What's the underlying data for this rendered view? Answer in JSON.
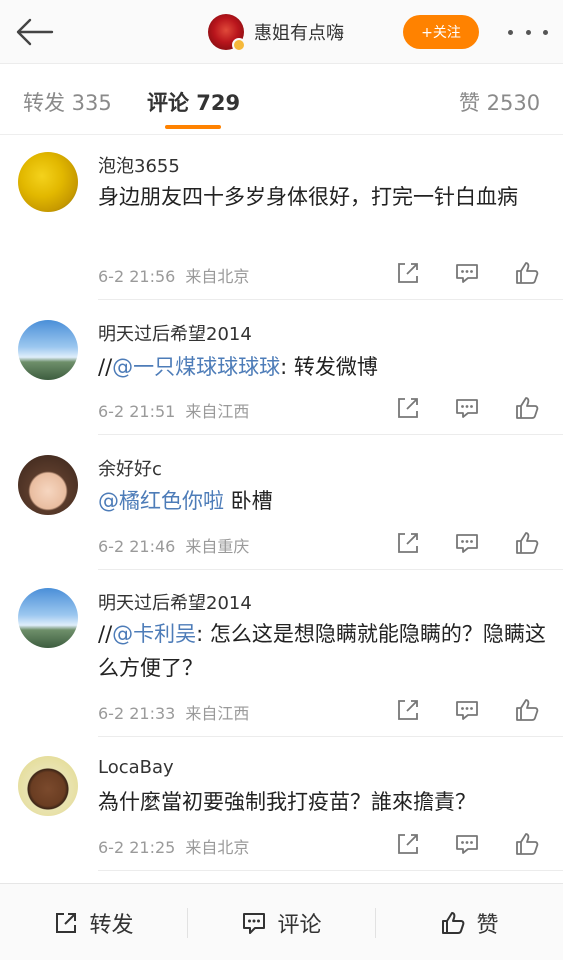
{
  "header": {
    "user_name": "惠姐有点嗨",
    "follow_label": "+关注",
    "back_icon": "arrow-left-icon",
    "more_icon": "more-dots-icon"
  },
  "tabs": [
    {
      "label": "转发 335"
    },
    {
      "label": "评论 729"
    },
    {
      "label": "赞 2530"
    }
  ],
  "comments": [
    {
      "name": "泡泡3655",
      "segments": [
        {
          "text": "身边朋友四十多岁身体很好，打完一针白血病",
          "mention": false
        }
      ],
      "time": "6-2 21:56",
      "source": "来自北京"
    },
    {
      "name": "明天过后希望2014",
      "segments": [
        {
          "text": "//",
          "mention": false
        },
        {
          "text": "@一只煤球球球球",
          "mention": true
        },
        {
          "text": ": 转发微博",
          "mention": false
        }
      ],
      "time": "6-2 21:51",
      "source": "来自江西"
    },
    {
      "name": "余好好c",
      "segments": [
        {
          "text": "@橘红色你啦",
          "mention": true
        },
        {
          "text": " 卧槽",
          "mention": false
        }
      ],
      "time": "6-2 21:46",
      "source": "来自重庆"
    },
    {
      "name": "明天过后希望2014",
      "segments": [
        {
          "text": "//",
          "mention": false
        },
        {
          "text": "@卡利吴",
          "mention": true
        },
        {
          "text": ": 怎么这是想隐瞒就能隐瞒的？隐瞒这么方便了？",
          "mention": false
        }
      ],
      "time": "6-2 21:33",
      "source": "来自江西"
    },
    {
      "name": "LocaBay",
      "segments": [
        {
          "text": "為什麼當初要強制我打疫苗？誰來擔責？",
          "mention": false
        }
      ],
      "time": "6-2 21:25",
      "source": "来自北京"
    }
  ],
  "bottom_bar": {
    "repost_label": "转发",
    "comment_label": "评论",
    "like_label": "赞"
  },
  "colors": {
    "accent": "#ff8200",
    "mention": "#4d7cb8",
    "meta": "#9a9a9a"
  }
}
